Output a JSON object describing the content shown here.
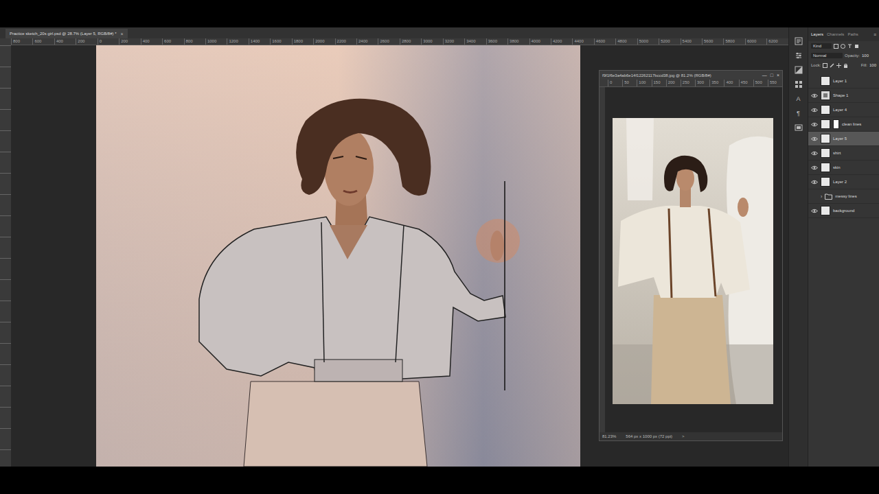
{
  "document_tab": {
    "title": "Practice sketch_20s girl.psd @ 28.7% (Layer 5, RGB/8#) *",
    "close": "×"
  },
  "ruler": {
    "ticks": [
      "800",
      "600",
      "400",
      "200",
      "0",
      "200",
      "400",
      "600",
      "800",
      "1000",
      "1200",
      "1400",
      "1600",
      "1800",
      "2000",
      "2200",
      "2400",
      "2600",
      "2800",
      "3000",
      "3200",
      "3400",
      "3600",
      "3800",
      "4000",
      "4200",
      "4400",
      "4600",
      "4800",
      "5000",
      "5200",
      "5400",
      "5600",
      "5800",
      "6000",
      "6200"
    ]
  },
  "reference_window": {
    "title": "f9f1f6e3a4ab6e14f12262117bccd38.jpg @ 81.2% (RGB/8#)",
    "controls": [
      "—",
      "□",
      "×"
    ],
    "ruler_ticks": [
      "0",
      "50",
      "100",
      "150",
      "200",
      "250",
      "300",
      "350",
      "400",
      "450",
      "500",
      "550"
    ],
    "zoom": "81.23%",
    "doc_info": "564 px x 1000 px (72 ppi)",
    "arrow": ">"
  },
  "side_tools": [
    "A",
    "¶"
  ],
  "layers_panel": {
    "tabs": [
      {
        "label": "Layers",
        "selected": true
      },
      {
        "label": "Channels",
        "selected": false
      },
      {
        "label": "Paths",
        "selected": false
      }
    ],
    "menu": "≡",
    "filter": "Kind",
    "blend_mode": "Normal",
    "opacity_label": "Opacity:",
    "opacity": "100",
    "lock_label": "Lock:",
    "fill_label": "Fill:",
    "fill": "100",
    "layers": [
      {
        "name": "Layer 1",
        "visible": false,
        "selected": false,
        "kind": "pixel"
      },
      {
        "name": "Shape 1",
        "visible": true,
        "selected": false,
        "kind": "shape"
      },
      {
        "name": "Layer 4",
        "visible": true,
        "selected": false,
        "kind": "pixel"
      },
      {
        "name": "clean lines",
        "visible": true,
        "selected": false,
        "kind": "masked"
      },
      {
        "name": "Layer 5",
        "visible": true,
        "selected": true,
        "kind": "pixel"
      },
      {
        "name": "shirt",
        "visible": true,
        "selected": false,
        "kind": "pixel"
      },
      {
        "name": "skin",
        "visible": true,
        "selected": false,
        "kind": "pixel"
      },
      {
        "name": "Layer 2",
        "visible": true,
        "selected": false,
        "kind": "pixel"
      },
      {
        "name": "messy lines",
        "visible": false,
        "selected": false,
        "kind": "group",
        "toggle": "›"
      },
      {
        "name": "background",
        "visible": true,
        "selected": false,
        "kind": "pixel"
      }
    ]
  }
}
